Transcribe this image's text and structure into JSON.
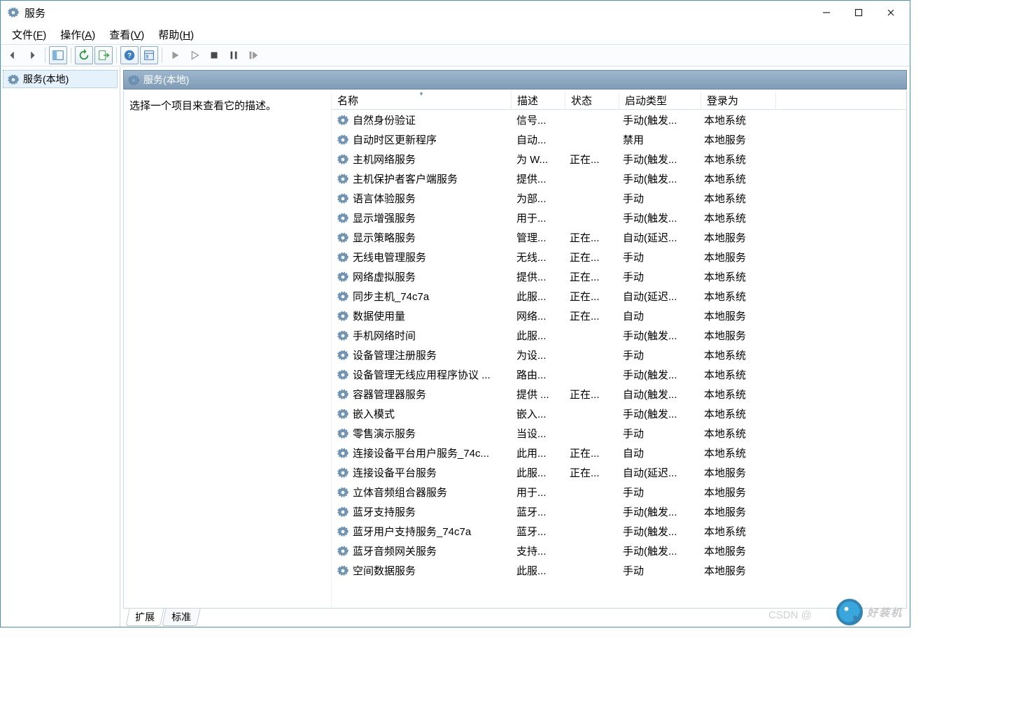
{
  "window": {
    "title": "服务"
  },
  "menu": {
    "file": {
      "label": "文件",
      "accel": "F"
    },
    "action": {
      "label": "操作",
      "accel": "A"
    },
    "view": {
      "label": "查看",
      "accel": "V"
    },
    "help": {
      "label": "帮助",
      "accel": "H"
    }
  },
  "tree": {
    "root": "服务(本地)"
  },
  "pane": {
    "title": "服务(本地)",
    "description_prompt": "选择一个项目来查看它的描述。"
  },
  "columns": {
    "name": "名称",
    "desc": "描述",
    "state": "状态",
    "start": "启动类型",
    "logon": "登录为"
  },
  "tabs": {
    "extended": "扩展",
    "standard": "标准"
  },
  "watermark": {
    "csdn": "CSDN @",
    "brand": "好装机"
  },
  "services": [
    {
      "name": "自然身份验证",
      "desc": "信号...",
      "state": "",
      "start": "手动(触发...",
      "logon": "本地系统"
    },
    {
      "name": "自动时区更新程序",
      "desc": "自动...",
      "state": "",
      "start": "禁用",
      "logon": "本地服务"
    },
    {
      "name": "主机网络服务",
      "desc": "为 W...",
      "state": "正在...",
      "start": "手动(触发...",
      "logon": "本地系统"
    },
    {
      "name": "主机保护者客户端服务",
      "desc": "提供...",
      "state": "",
      "start": "手动(触发...",
      "logon": "本地系统"
    },
    {
      "name": "语言体验服务",
      "desc": "为部...",
      "state": "",
      "start": "手动",
      "logon": "本地系统"
    },
    {
      "name": "显示增强服务",
      "desc": "用于...",
      "state": "",
      "start": "手动(触发...",
      "logon": "本地系统"
    },
    {
      "name": "显示策略服务",
      "desc": "管理...",
      "state": "正在...",
      "start": "自动(延迟...",
      "logon": "本地服务"
    },
    {
      "name": "无线电管理服务",
      "desc": "无线...",
      "state": "正在...",
      "start": "手动",
      "logon": "本地服务"
    },
    {
      "name": "网络虚拟服务",
      "desc": "提供...",
      "state": "正在...",
      "start": "手动",
      "logon": "本地系统"
    },
    {
      "name": "同步主机_74c7a",
      "desc": "此服...",
      "state": "正在...",
      "start": "自动(延迟...",
      "logon": "本地系统"
    },
    {
      "name": "数据使用量",
      "desc": "网络...",
      "state": "正在...",
      "start": "自动",
      "logon": "本地服务"
    },
    {
      "name": "手机网络时间",
      "desc": "此服...",
      "state": "",
      "start": "手动(触发...",
      "logon": "本地服务"
    },
    {
      "name": "设备管理注册服务",
      "desc": "为设...",
      "state": "",
      "start": "手动",
      "logon": "本地系统"
    },
    {
      "name": "设备管理无线应用程序协议 ...",
      "desc": "路由...",
      "state": "",
      "start": "手动(触发...",
      "logon": "本地系统"
    },
    {
      "name": "容器管理器服务",
      "desc": "提供 ...",
      "state": "正在...",
      "start": "自动(触发...",
      "logon": "本地系统"
    },
    {
      "name": "嵌入模式",
      "desc": "嵌入...",
      "state": "",
      "start": "手动(触发...",
      "logon": "本地系统"
    },
    {
      "name": "零售演示服务",
      "desc": "当设...",
      "state": "",
      "start": "手动",
      "logon": "本地系统"
    },
    {
      "name": "连接设备平台用户服务_74c...",
      "desc": "此用...",
      "state": "正在...",
      "start": "自动",
      "logon": "本地系统"
    },
    {
      "name": "连接设备平台服务",
      "desc": "此服...",
      "state": "正在...",
      "start": "自动(延迟...",
      "logon": "本地服务"
    },
    {
      "name": "立体音频组合器服务",
      "desc": "用于...",
      "state": "",
      "start": "手动",
      "logon": "本地服务"
    },
    {
      "name": "蓝牙支持服务",
      "desc": "蓝牙...",
      "state": "",
      "start": "手动(触发...",
      "logon": "本地服务"
    },
    {
      "name": "蓝牙用户支持服务_74c7a",
      "desc": "蓝牙...",
      "state": "",
      "start": "手动(触发...",
      "logon": "本地系统"
    },
    {
      "name": "蓝牙音频网关服务",
      "desc": "支持...",
      "state": "",
      "start": "手动(触发...",
      "logon": "本地服务"
    },
    {
      "name": "空间数据服务",
      "desc": "此服...",
      "state": "",
      "start": "手动",
      "logon": "本地服务"
    }
  ]
}
